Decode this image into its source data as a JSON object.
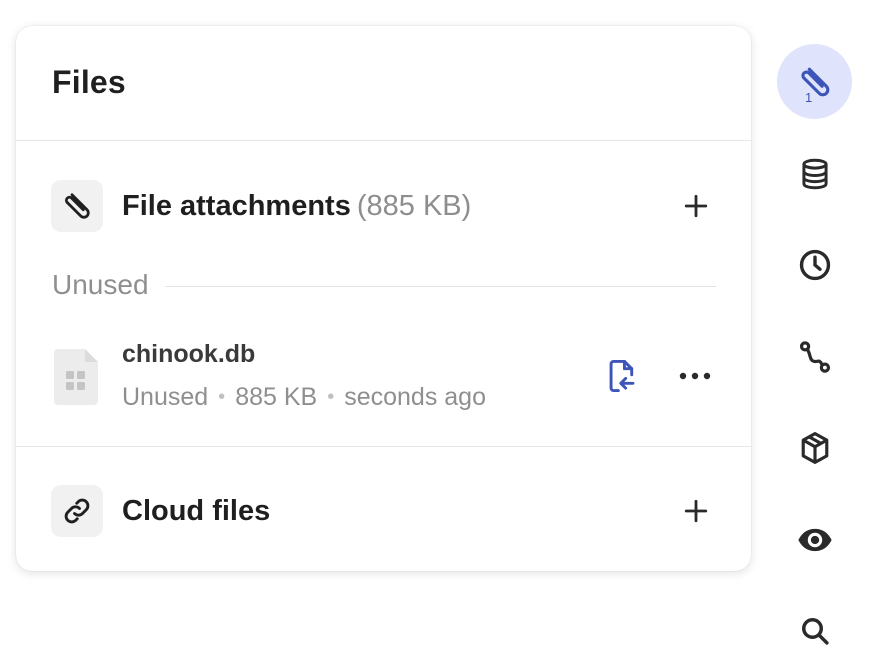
{
  "panel": {
    "title": "Files",
    "attachments": {
      "label": "File attachments",
      "size": "(885 KB)"
    },
    "groups": [
      {
        "label": "Unused",
        "files": [
          {
            "name": "chinook.db",
            "status": "Unused",
            "size": "885 KB",
            "time": "seconds ago"
          }
        ]
      }
    ],
    "cloud": {
      "label": "Cloud files"
    }
  },
  "rail": {
    "items": [
      {
        "name": "files",
        "icon": "paperclip-icon",
        "active": true,
        "badge": "1"
      },
      {
        "name": "databases",
        "icon": "database-icon"
      },
      {
        "name": "history",
        "icon": "clock-icon"
      },
      {
        "name": "routes",
        "icon": "route-icon"
      },
      {
        "name": "packages",
        "icon": "package-icon"
      },
      {
        "name": "preview",
        "icon": "eye-icon"
      },
      {
        "name": "search",
        "icon": "search-icon"
      }
    ]
  },
  "colors": {
    "accent": "#3d54b8",
    "accent_bg": "#dfe4fc",
    "muted": "#8f8f8f"
  }
}
